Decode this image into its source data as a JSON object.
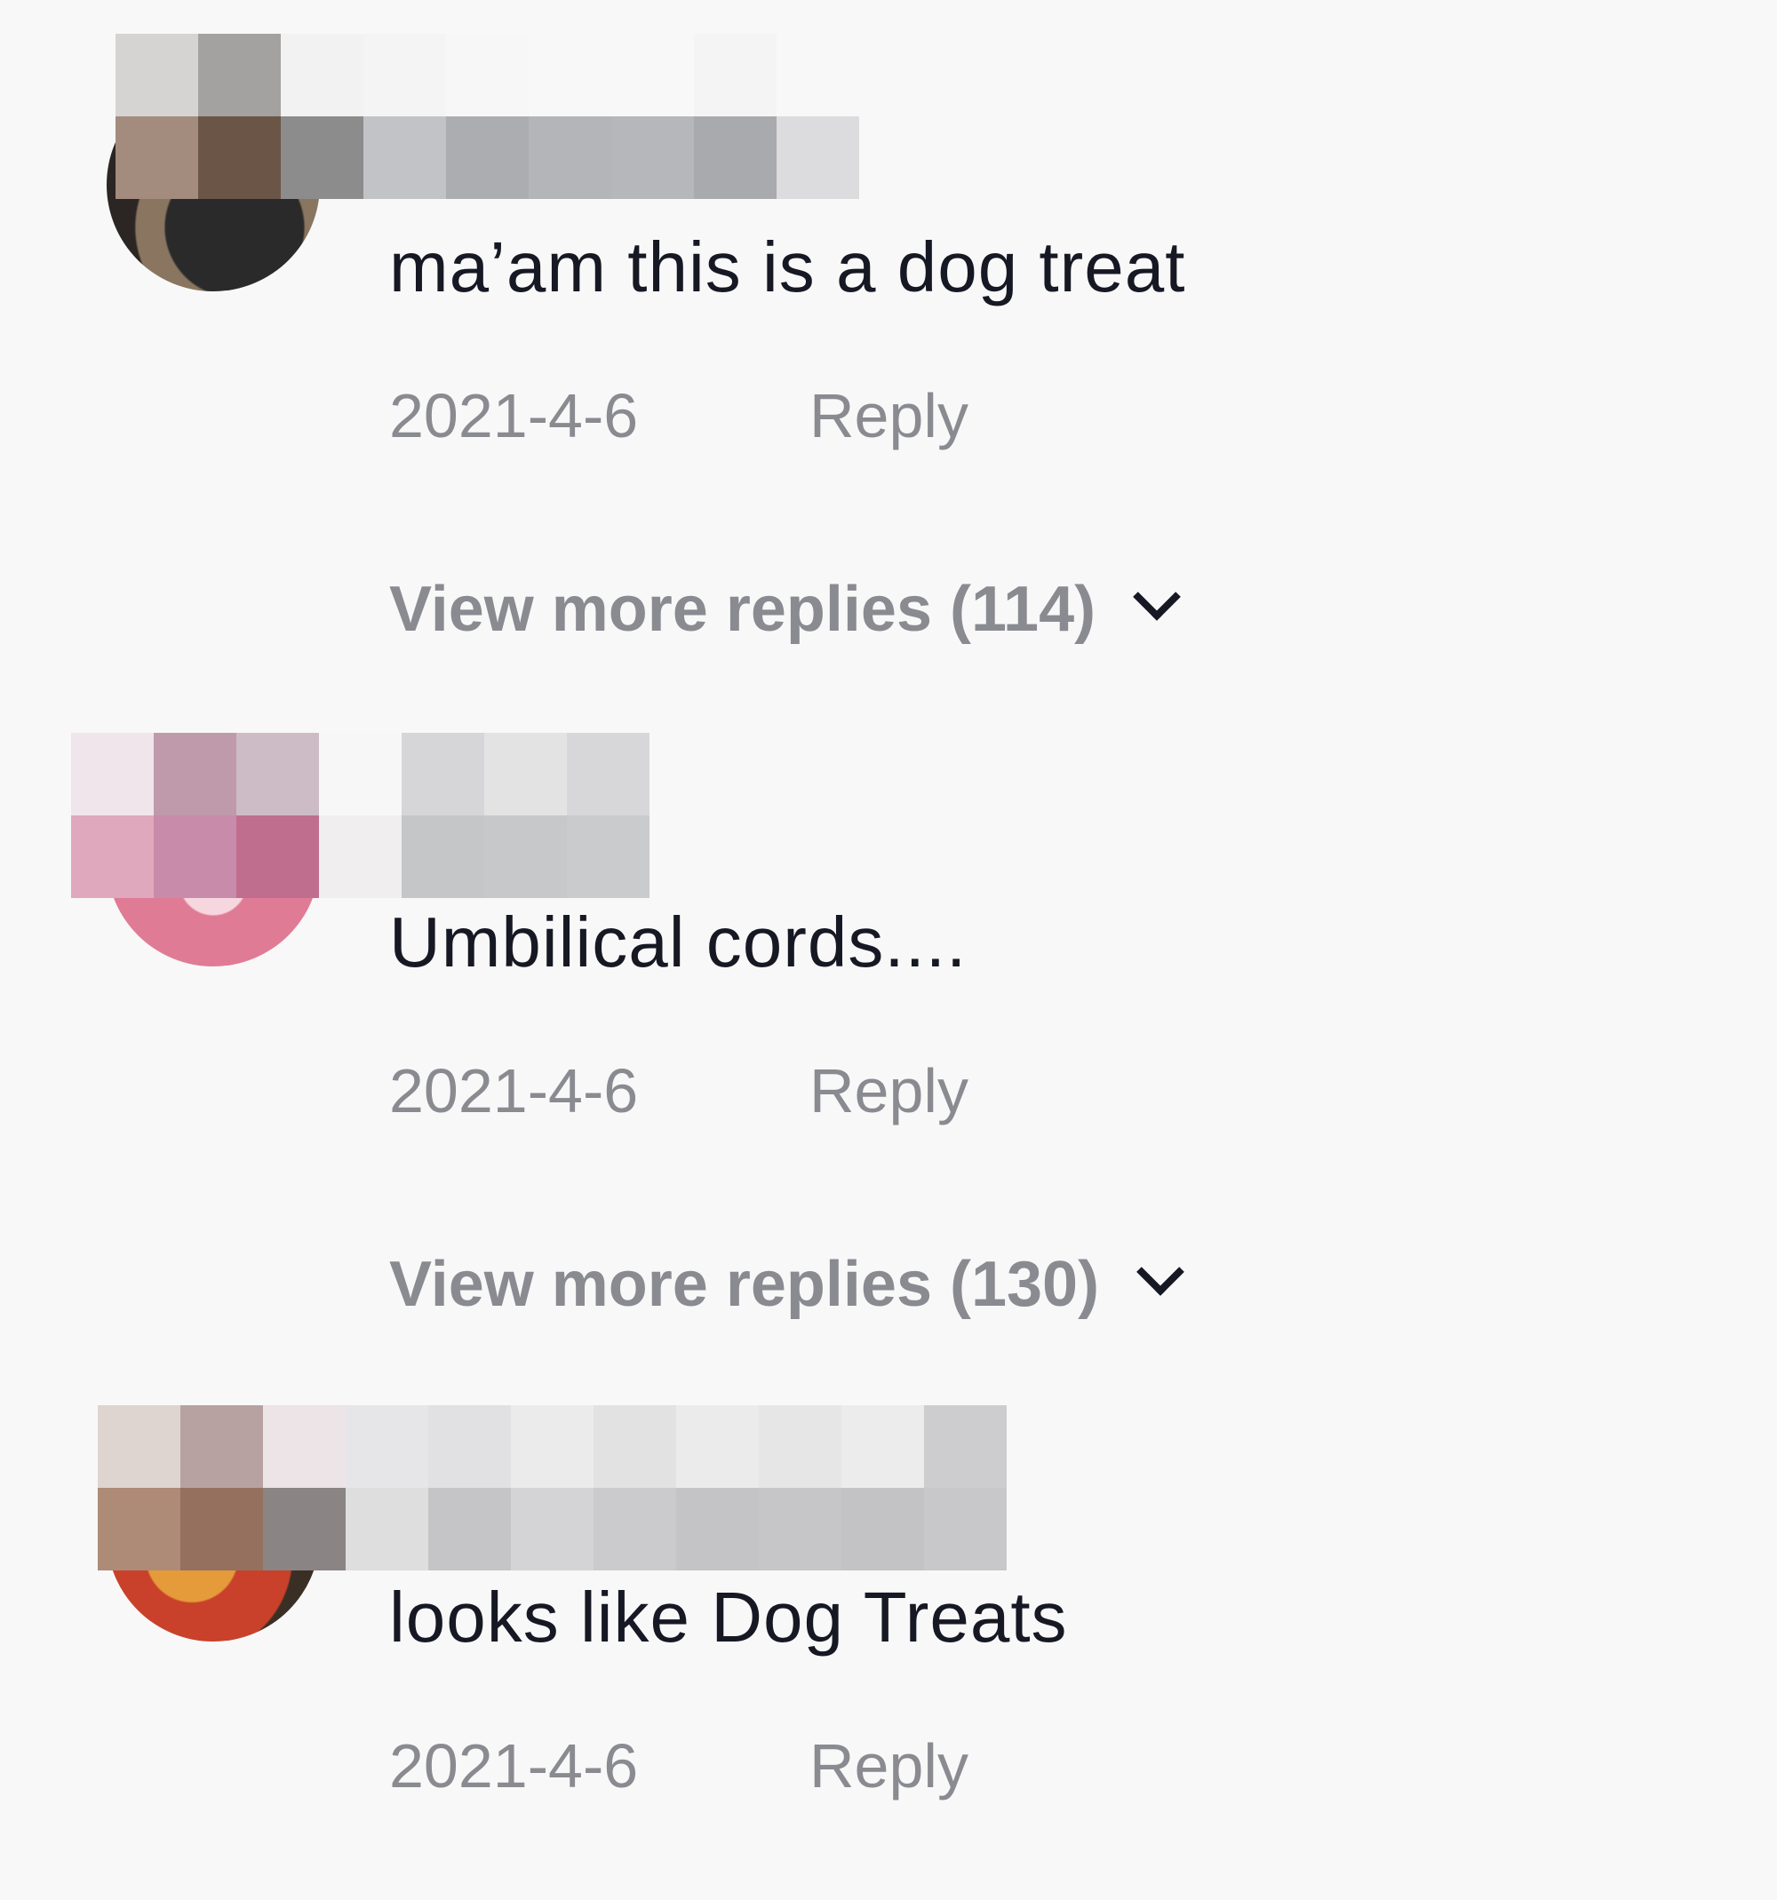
{
  "comments": [
    {
      "text": "ma’am this is a dog treat",
      "date": "2021-4-6",
      "reply_label": "Reply",
      "view_more": "View more replies (114)"
    },
    {
      "text": "Umbilical cords....",
      "date": "2021-4-6",
      "reply_label": "Reply",
      "view_more": "View more replies (130)"
    },
    {
      "text": "looks like Dog Treats",
      "date": "2021-4-6",
      "reply_label": "Reply"
    }
  ],
  "icons": {
    "expand": "chevron-down-icon"
  },
  "colors": {
    "background": "#f8f8f8",
    "text_primary": "#161823",
    "text_secondary": "#8a8b91"
  }
}
